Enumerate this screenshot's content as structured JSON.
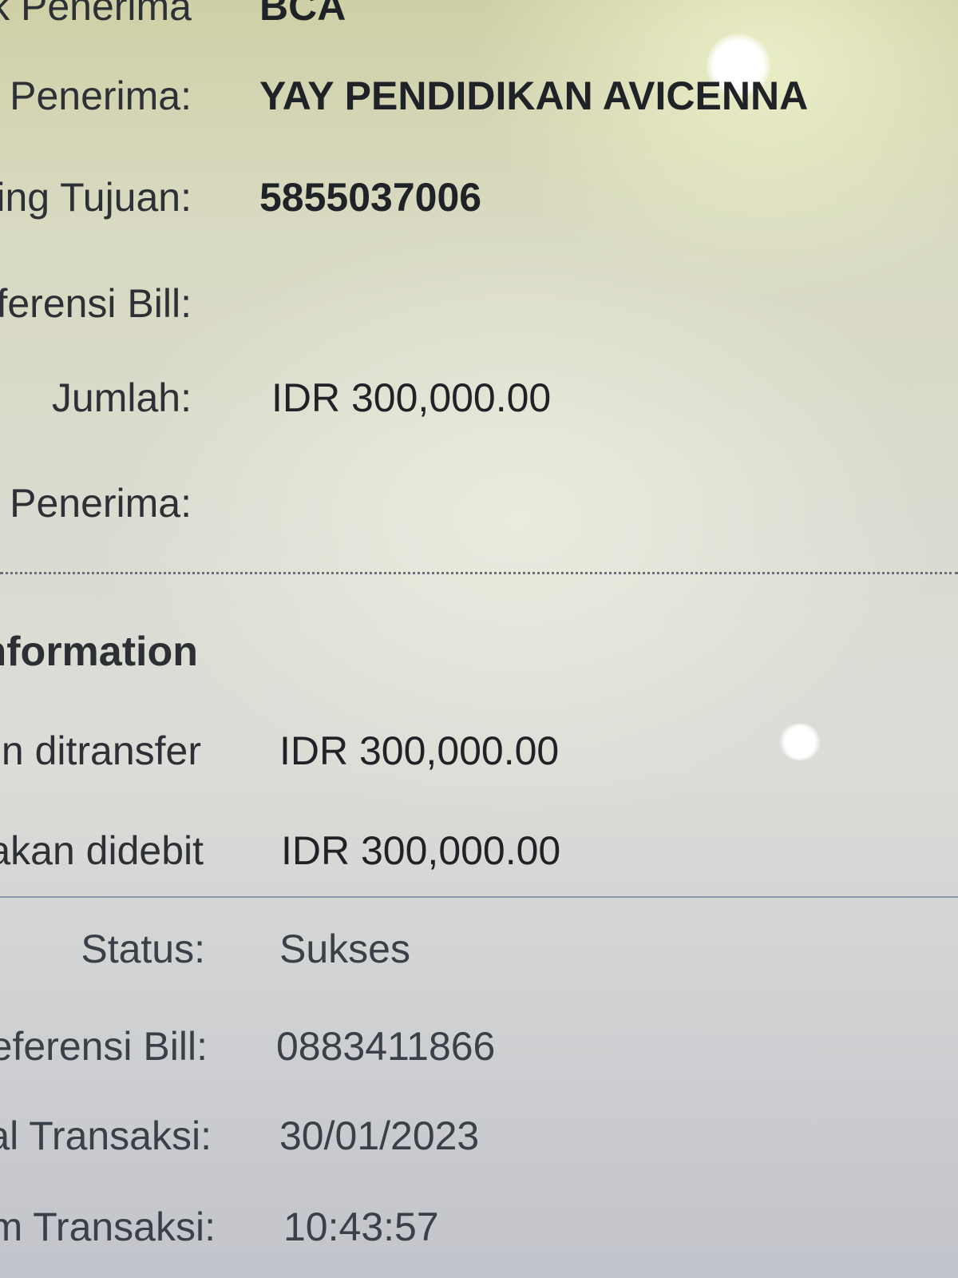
{
  "rows_top": [
    {
      "label": "k Penerima",
      "value": "BCA"
    },
    {
      "label": "Penerima:",
      "value": "YAY PENDIDIKAN AVICENNA"
    },
    {
      "label": "ing Tujuan:",
      "value": "5855037006"
    },
    {
      "label": "ferensi Bill:",
      "value": ""
    },
    {
      "label": "Jumlah:",
      "value": "IDR 300,000.00"
    },
    {
      "label": "l Penerima:",
      "value": ""
    }
  ],
  "information": {
    "title": "nformation",
    "rows": [
      {
        "label": "n ditransfer",
        "value": "IDR 300,000.00"
      },
      {
        "label": "akan didebit",
        "value": "IDR 300,000.00"
      }
    ]
  },
  "result": {
    "status_label": "Status:",
    "status_value": "Sukses",
    "status_color": "#2d8f2f",
    "rows": [
      {
        "label": "eferensi Bill:",
        "value": "0883411866"
      },
      {
        "label": "al Transaksi:",
        "value": "30/01/2023"
      },
      {
        "label": "m Transaksi:",
        "value": "10:43:57"
      }
    ]
  }
}
